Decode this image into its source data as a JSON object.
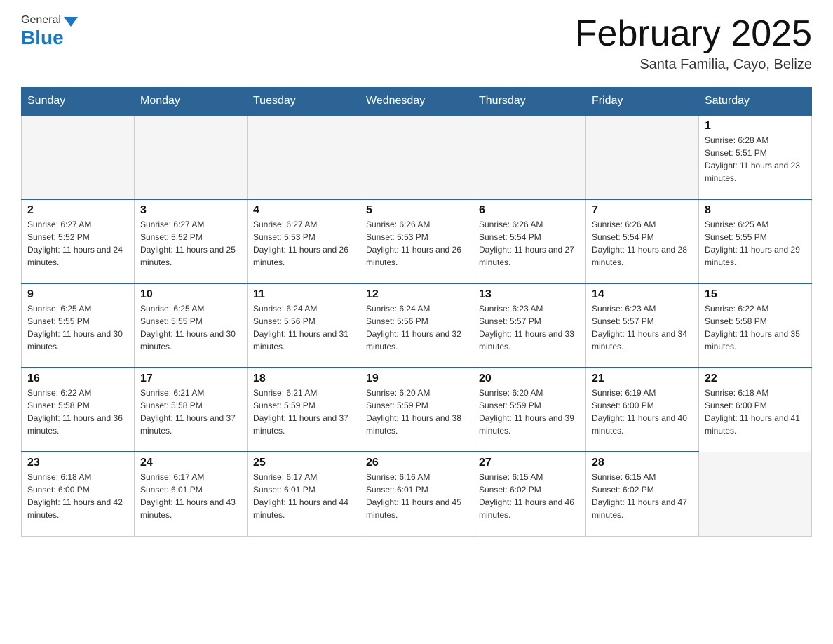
{
  "header": {
    "logo_general": "General",
    "logo_blue": "Blue",
    "title": "February 2025",
    "subtitle": "Santa Familia, Cayo, Belize"
  },
  "days_of_week": [
    "Sunday",
    "Monday",
    "Tuesday",
    "Wednesday",
    "Thursday",
    "Friday",
    "Saturday"
  ],
  "weeks": [
    {
      "days": [
        {
          "date": "",
          "empty": true
        },
        {
          "date": "",
          "empty": true
        },
        {
          "date": "",
          "empty": true
        },
        {
          "date": "",
          "empty": true
        },
        {
          "date": "",
          "empty": true
        },
        {
          "date": "",
          "empty": true
        },
        {
          "date": "1",
          "sunrise": "Sunrise: 6:28 AM",
          "sunset": "Sunset: 5:51 PM",
          "daylight": "Daylight: 11 hours and 23 minutes."
        }
      ]
    },
    {
      "days": [
        {
          "date": "2",
          "sunrise": "Sunrise: 6:27 AM",
          "sunset": "Sunset: 5:52 PM",
          "daylight": "Daylight: 11 hours and 24 minutes."
        },
        {
          "date": "3",
          "sunrise": "Sunrise: 6:27 AM",
          "sunset": "Sunset: 5:52 PM",
          "daylight": "Daylight: 11 hours and 25 minutes."
        },
        {
          "date": "4",
          "sunrise": "Sunrise: 6:27 AM",
          "sunset": "Sunset: 5:53 PM",
          "daylight": "Daylight: 11 hours and 26 minutes."
        },
        {
          "date": "5",
          "sunrise": "Sunrise: 6:26 AM",
          "sunset": "Sunset: 5:53 PM",
          "daylight": "Daylight: 11 hours and 26 minutes."
        },
        {
          "date": "6",
          "sunrise": "Sunrise: 6:26 AM",
          "sunset": "Sunset: 5:54 PM",
          "daylight": "Daylight: 11 hours and 27 minutes."
        },
        {
          "date": "7",
          "sunrise": "Sunrise: 6:26 AM",
          "sunset": "Sunset: 5:54 PM",
          "daylight": "Daylight: 11 hours and 28 minutes."
        },
        {
          "date": "8",
          "sunrise": "Sunrise: 6:25 AM",
          "sunset": "Sunset: 5:55 PM",
          "daylight": "Daylight: 11 hours and 29 minutes."
        }
      ]
    },
    {
      "days": [
        {
          "date": "9",
          "sunrise": "Sunrise: 6:25 AM",
          "sunset": "Sunset: 5:55 PM",
          "daylight": "Daylight: 11 hours and 30 minutes."
        },
        {
          "date": "10",
          "sunrise": "Sunrise: 6:25 AM",
          "sunset": "Sunset: 5:55 PM",
          "daylight": "Daylight: 11 hours and 30 minutes."
        },
        {
          "date": "11",
          "sunrise": "Sunrise: 6:24 AM",
          "sunset": "Sunset: 5:56 PM",
          "daylight": "Daylight: 11 hours and 31 minutes."
        },
        {
          "date": "12",
          "sunrise": "Sunrise: 6:24 AM",
          "sunset": "Sunset: 5:56 PM",
          "daylight": "Daylight: 11 hours and 32 minutes."
        },
        {
          "date": "13",
          "sunrise": "Sunrise: 6:23 AM",
          "sunset": "Sunset: 5:57 PM",
          "daylight": "Daylight: 11 hours and 33 minutes."
        },
        {
          "date": "14",
          "sunrise": "Sunrise: 6:23 AM",
          "sunset": "Sunset: 5:57 PM",
          "daylight": "Daylight: 11 hours and 34 minutes."
        },
        {
          "date": "15",
          "sunrise": "Sunrise: 6:22 AM",
          "sunset": "Sunset: 5:58 PM",
          "daylight": "Daylight: 11 hours and 35 minutes."
        }
      ]
    },
    {
      "days": [
        {
          "date": "16",
          "sunrise": "Sunrise: 6:22 AM",
          "sunset": "Sunset: 5:58 PM",
          "daylight": "Daylight: 11 hours and 36 minutes."
        },
        {
          "date": "17",
          "sunrise": "Sunrise: 6:21 AM",
          "sunset": "Sunset: 5:58 PM",
          "daylight": "Daylight: 11 hours and 37 minutes."
        },
        {
          "date": "18",
          "sunrise": "Sunrise: 6:21 AM",
          "sunset": "Sunset: 5:59 PM",
          "daylight": "Daylight: 11 hours and 37 minutes."
        },
        {
          "date": "19",
          "sunrise": "Sunrise: 6:20 AM",
          "sunset": "Sunset: 5:59 PM",
          "daylight": "Daylight: 11 hours and 38 minutes."
        },
        {
          "date": "20",
          "sunrise": "Sunrise: 6:20 AM",
          "sunset": "Sunset: 5:59 PM",
          "daylight": "Daylight: 11 hours and 39 minutes."
        },
        {
          "date": "21",
          "sunrise": "Sunrise: 6:19 AM",
          "sunset": "Sunset: 6:00 PM",
          "daylight": "Daylight: 11 hours and 40 minutes."
        },
        {
          "date": "22",
          "sunrise": "Sunrise: 6:18 AM",
          "sunset": "Sunset: 6:00 PM",
          "daylight": "Daylight: 11 hours and 41 minutes."
        }
      ]
    },
    {
      "days": [
        {
          "date": "23",
          "sunrise": "Sunrise: 6:18 AM",
          "sunset": "Sunset: 6:00 PM",
          "daylight": "Daylight: 11 hours and 42 minutes."
        },
        {
          "date": "24",
          "sunrise": "Sunrise: 6:17 AM",
          "sunset": "Sunset: 6:01 PM",
          "daylight": "Daylight: 11 hours and 43 minutes."
        },
        {
          "date": "25",
          "sunrise": "Sunrise: 6:17 AM",
          "sunset": "Sunset: 6:01 PM",
          "daylight": "Daylight: 11 hours and 44 minutes."
        },
        {
          "date": "26",
          "sunrise": "Sunrise: 6:16 AM",
          "sunset": "Sunset: 6:01 PM",
          "daylight": "Daylight: 11 hours and 45 minutes."
        },
        {
          "date": "27",
          "sunrise": "Sunrise: 6:15 AM",
          "sunset": "Sunset: 6:02 PM",
          "daylight": "Daylight: 11 hours and 46 minutes."
        },
        {
          "date": "28",
          "sunrise": "Sunrise: 6:15 AM",
          "sunset": "Sunset: 6:02 PM",
          "daylight": "Daylight: 11 hours and 47 minutes."
        },
        {
          "date": "",
          "empty": true
        }
      ]
    }
  ]
}
